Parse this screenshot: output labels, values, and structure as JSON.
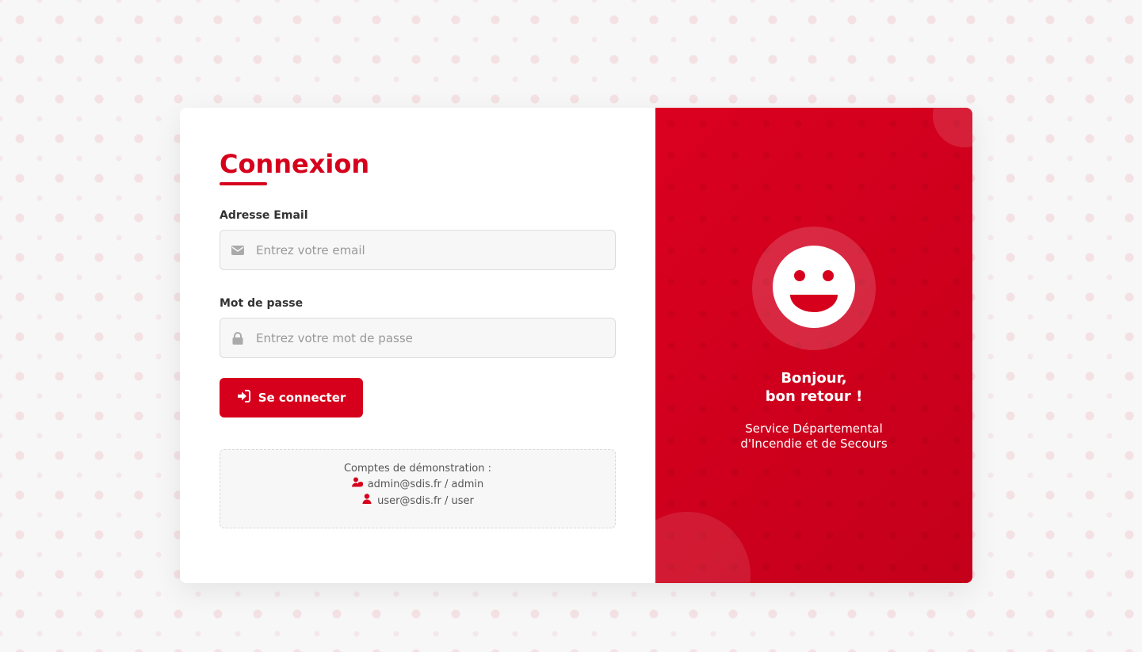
{
  "login": {
    "title": "Connexion",
    "email_label": "Adresse Email",
    "email_placeholder": "Entrez votre email",
    "email_value": "",
    "password_label": "Mot de passe",
    "password_placeholder": "Entrez votre mot de passe",
    "password_value": "",
    "submit_label": "Se connecter"
  },
  "demo": {
    "title": "Comptes de démonstration :",
    "accounts": [
      {
        "text": "admin@sdis.fr / admin",
        "icon": "user-shield-icon"
      },
      {
        "text": "user@sdis.fr / user",
        "icon": "user-icon"
      }
    ]
  },
  "welcome": {
    "greeting_line1": "Bonjour,",
    "greeting_line2": "bon retour !",
    "service_line1": "Service Départemental",
    "service_line2": "d'Incendie et de Secours",
    "icon": "smiley-icon"
  },
  "colors": {
    "accent": "#d6001c",
    "background": "#f7f7f7"
  }
}
